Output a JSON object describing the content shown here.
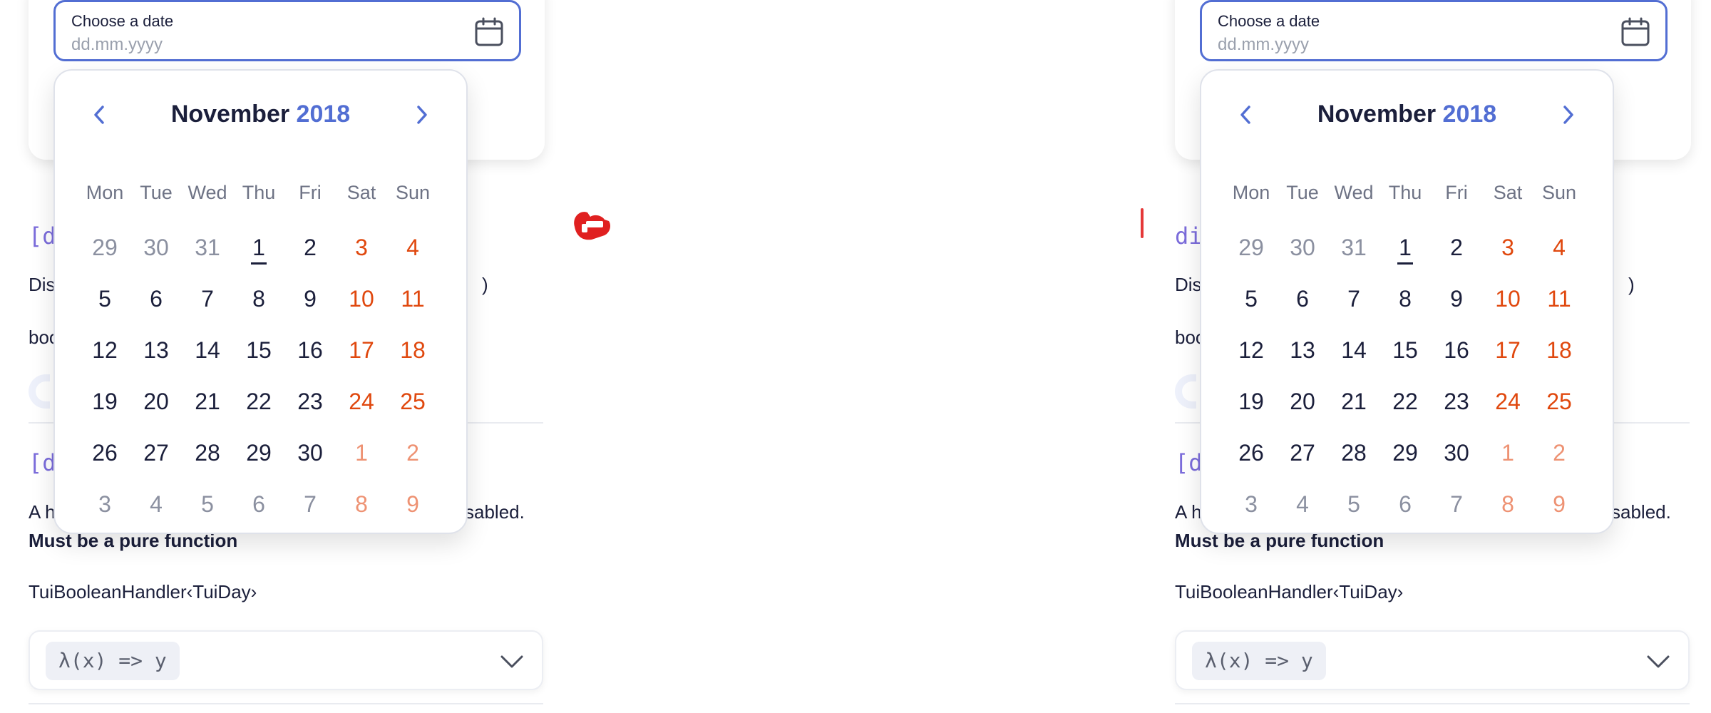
{
  "date_input": {
    "label": "Choose a date",
    "placeholder": "dd.mm.yyyy"
  },
  "calendar": {
    "month": "November",
    "year": "2018",
    "weekdays": [
      "Mon",
      "Tue",
      "Wed",
      "Thu",
      "Fri",
      "Sat",
      "Sun"
    ],
    "weeks": [
      [
        "29",
        "30",
        "31",
        "1",
        "2",
        "3",
        "4"
      ],
      [
        "5",
        "6",
        "7",
        "8",
        "9",
        "10",
        "11"
      ],
      [
        "12",
        "13",
        "14",
        "15",
        "16",
        "17",
        "18"
      ],
      [
        "19",
        "20",
        "21",
        "22",
        "23",
        "24",
        "25"
      ],
      [
        "26",
        "27",
        "28",
        "29",
        "30",
        "1",
        "2"
      ],
      [
        "3",
        "4",
        "5",
        "6",
        "7",
        "8",
        "9"
      ]
    ],
    "outside_month_cells": [
      [
        0,
        0
      ],
      [
        0,
        1
      ],
      [
        0,
        2
      ],
      [
        4,
        5
      ],
      [
        4,
        6
      ],
      [
        5,
        0
      ],
      [
        5,
        1
      ],
      [
        5,
        2
      ],
      [
        5,
        3
      ],
      [
        5,
        4
      ],
      [
        5,
        5
      ],
      [
        5,
        6
      ]
    ],
    "today_cell": [
      0,
      3
    ],
    "colors": {
      "accent": "#526ed3",
      "weekend": "#e0480e",
      "text": "#1b1f3b"
    }
  },
  "doc": {
    "left": {
      "code1": "[d",
      "line_dis": "Dis",
      "paren": ")",
      "line_boo": "boo",
      "code2": "[d",
      "desc_start": "A h",
      "desc_end": "sabled.",
      "pure_function": "Must be a pure function",
      "type": "TuiBooleanHandler‹TuiDay›",
      "lambda": "λ(x) => y"
    },
    "right": {
      "code1": "di",
      "line_dis": "Dis",
      "paren": ")",
      "line_boo": "boo",
      "code2": "[d",
      "desc_start": "A h",
      "desc_end": "sabled.",
      "pure_function": "Must be a pure function",
      "type": "TuiBooleanHandler‹TuiDay›",
      "lambda": "λ(x) => y"
    }
  },
  "icons": {
    "calendar": "calendar-icon",
    "prev": "chevron-left-icon",
    "next": "chevron-right-icon",
    "expand": "chevron-down-icon",
    "cursor": "hand-pointer-icon"
  }
}
